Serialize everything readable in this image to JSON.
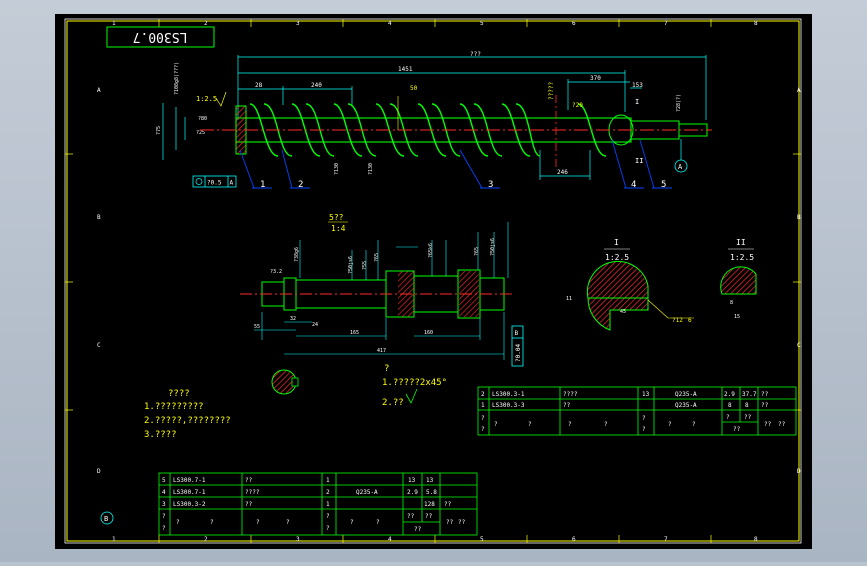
{
  "colors": {
    "sheet": "#000000",
    "frame": "#ffffff",
    "border": "#ffff00",
    "outline": "#00ff00",
    "dimension": "#00ffff",
    "centerline": "#ff2a2a",
    "hatch": "#ff2a2a",
    "text": "#ffffff",
    "note": "#ffff00"
  },
  "drawing": {
    "number": "LS300.7",
    "zone_cols": [
      "1",
      "2",
      "3",
      "4",
      "5",
      "6",
      "7",
      "8"
    ],
    "zone_rows": [
      "A",
      "B",
      "C",
      "D"
    ],
    "main_view": {
      "dims": [
        "???",
        "1451",
        "???",
        "28",
        "240",
        "50",
        "370",
        "153",
        "???",
        "?20",
        "246"
      ],
      "balloons": [
        "1",
        "2",
        "3",
        "4",
        "5"
      ],
      "datum": "A",
      "section_marks": [
        "I",
        "II"
      ],
      "note_tag": "?????",
      "geo_tol": "?0.5",
      "side_dims": [
        "?108g8(???)",
        "?75",
        "?80",
        "?25",
        "?28(?)"
      ],
      "vertical_dims": [
        "?130",
        "?130"
      ]
    },
    "shaft_view": {
      "scale_note_1": "5??",
      "scale_note_2": "1:4",
      "dims_bottom": [
        "55",
        "32",
        "24",
        "165",
        "160",
        "417"
      ],
      "dims_top": [
        "?38g6",
        "?50js6",
        "?55",
        "?65",
        "?65k6",
        "?65",
        "?50js6"
      ],
      "runout": "?0.04",
      "datum": "B",
      "chamfer": "?3.2"
    },
    "detail_views": [
      {
        "label": "I",
        "scale": "1:2.5",
        "dims": [
          "11",
          "45",
          "?12",
          "6"
        ]
      },
      {
        "label": "II",
        "scale": "1:2.5",
        "dims": [
          "8",
          "15"
        ]
      }
    ],
    "tech_notes": {
      "title": "????",
      "items": [
        "1.?????????",
        "2.?????,????????",
        "3.????"
      ]
    },
    "shaft_notes": {
      "mark": "?",
      "items": [
        "1.?????2x45°",
        "2.??"
      ]
    },
    "parts_table_right": {
      "rows": [
        [
          "2",
          "LS300.3-1",
          "????",
          "",
          "13",
          "Q235-A",
          "2.9",
          "37.7",
          "??"
        ],
        [
          "1",
          "LS300.3-3",
          "??",
          "",
          "",
          "Q235-A",
          "8",
          "8",
          "??"
        ]
      ],
      "header": [
        "?",
        "?",
        "?",
        "?",
        "?",
        "?",
        "?",
        "??",
        "??"
      ],
      "footer_right": "??"
    },
    "parts_table_left": {
      "rows": [
        [
          "5",
          "LS300.7-1",
          "??",
          "",
          "1",
          "",
          "13",
          "13",
          ""
        ],
        [
          "4",
          "LS300.7-1",
          "????",
          "",
          "2",
          "Q235-A",
          "2.9",
          "5.8",
          ""
        ],
        [
          "3",
          "LS300.3-2",
          "??",
          "",
          "1",
          "",
          "",
          "128",
          "??"
        ]
      ],
      "header": [
        "?",
        "?",
        "?",
        "?",
        "?",
        "?",
        "??",
        "??",
        "??"
      ],
      "footer_right": "??"
    }
  }
}
